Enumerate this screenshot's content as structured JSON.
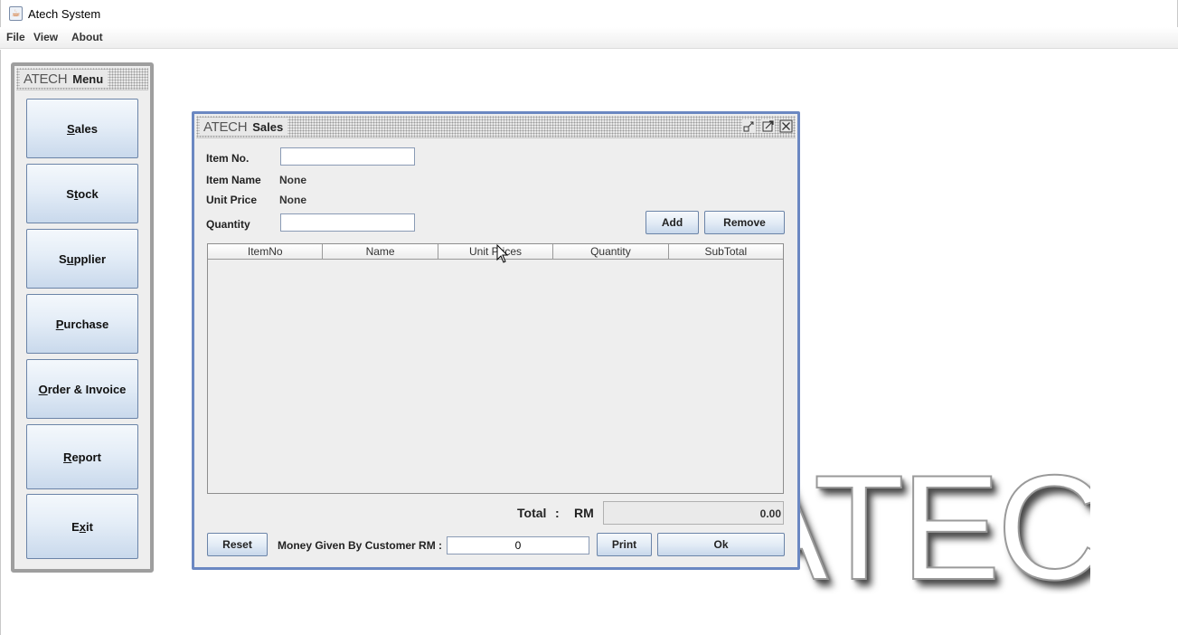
{
  "window": {
    "title": "Atech System"
  },
  "menubar": {
    "items": [
      "File",
      "View",
      "About"
    ]
  },
  "background_logo": {
    "text": "ATECH"
  },
  "menu_frame": {
    "logo": "ATECH",
    "title": "Menu",
    "buttons": [
      {
        "pre": "",
        "mnemonic": "S",
        "post": "ales"
      },
      {
        "pre": "S",
        "mnemonic": "t",
        "post": "ock"
      },
      {
        "pre": "S",
        "mnemonic": "u",
        "post": "pplier"
      },
      {
        "pre": "",
        "mnemonic": "P",
        "post": "urchase"
      },
      {
        "pre": "",
        "mnemonic": "O",
        "post": "rder & Invoice"
      },
      {
        "pre": "",
        "mnemonic": "R",
        "post": "eport"
      },
      {
        "pre": "E",
        "mnemonic": "x",
        "post": "it"
      }
    ]
  },
  "sales_frame": {
    "logo": "ATECH",
    "title": "Sales",
    "window_controls": [
      "iconify-icon",
      "maximize-icon",
      "close-icon"
    ],
    "fields": {
      "item_no": {
        "label": "Item No.",
        "value": ""
      },
      "item_name": {
        "label": "Item Name",
        "value": "None"
      },
      "unit_price": {
        "label": "Unit Price",
        "value": "None"
      },
      "quantity": {
        "label": "Quantity",
        "value": ""
      }
    },
    "buttons": {
      "add": "Add",
      "remove": "Remove",
      "reset": "Reset",
      "print": "Print",
      "ok": "Ok"
    },
    "table": {
      "columns": [
        "ItemNo",
        "Name",
        "Unit Prices",
        "Quantity",
        "SubTotal"
      ],
      "rows": []
    },
    "total": {
      "label": "Total",
      "separator": ":",
      "currency": "RM",
      "value": "0.00"
    },
    "money_given": {
      "label": "Money Given By Customer RM :",
      "value": "0"
    }
  },
  "colors": {
    "frame_active_border": "#6b88c2",
    "button_gradient_bottom": "#c8d8eb",
    "button_border": "#6b84a8"
  }
}
